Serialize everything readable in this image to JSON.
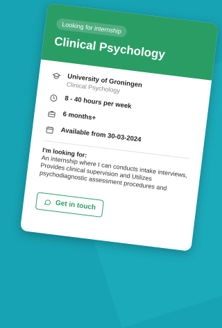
{
  "colors": {
    "background": "#17a3b3",
    "header": "#2a9d64",
    "accent": "#2a9d64"
  },
  "card": {
    "badge": "Looking for internship",
    "title": "Clinical Psychology",
    "university": {
      "name": "University of Groningen",
      "program": "Clinical Psychology",
      "icon": "graduation-cap-icon"
    },
    "hours": {
      "text": "8 - 40 hours per week",
      "icon": "clock-icon"
    },
    "duration": {
      "text": "6 months+",
      "icon": "briefcase-icon"
    },
    "availability": {
      "text": "Available from 30-03-2024",
      "icon": "calendar-icon"
    },
    "looking_for": {
      "label": "I'm looking for:",
      "lines": [
        "An internship where I can conducts intake interviews,",
        "Provides clinical supervision and Utilizes",
        "psychodiagnostic assessment procedures and"
      ]
    },
    "contact_button": {
      "label": "Get in touch",
      "icon": "chat-icon"
    }
  }
}
